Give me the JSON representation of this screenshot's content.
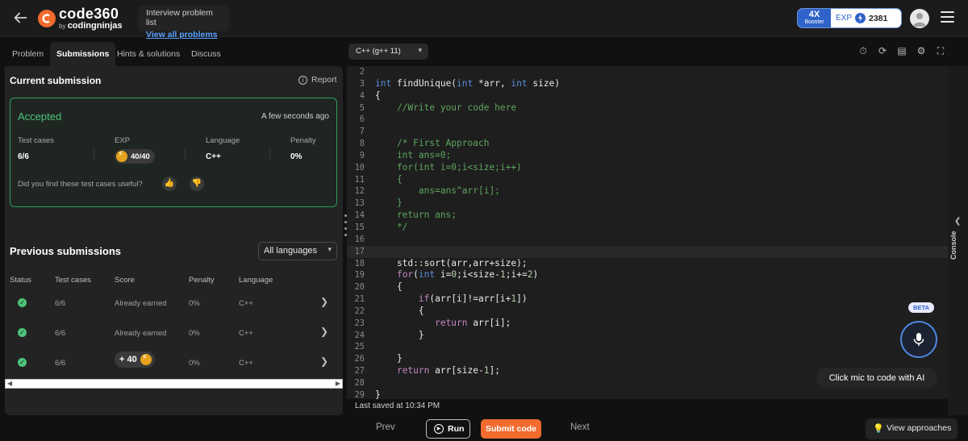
{
  "header": {
    "logo_main": "code360",
    "logo_by": "by",
    "logo_sub": "codingninjas",
    "list_title": "Interview problem list",
    "list_link": "View all problems",
    "booster_multiplier": "4X",
    "booster_label": "Booster",
    "exp_label": "EXP",
    "exp_value": "2381",
    "accent_color": "#f26b2e",
    "link_color": "#5aa2ff"
  },
  "left_tabs": [
    "Problem",
    "Submissions",
    "Hints & solutions",
    "Discuss"
  ],
  "current": {
    "title": "Current submission",
    "report": "Report",
    "status": "Accepted",
    "time": "A few seconds ago",
    "stats": [
      {
        "label": "Test cases",
        "value": "6/6"
      },
      {
        "label": "EXP",
        "value": "40/40"
      },
      {
        "label": "Language",
        "value": "C++"
      },
      {
        "label": "Penalty",
        "value": "0%"
      }
    ],
    "useful_question": "Did you find these test cases useful?"
  },
  "previous": {
    "title": "Previous submissions",
    "language_filter": "All languages",
    "headers": [
      "Status",
      "Test cases",
      "Score",
      "Penalty",
      "Language"
    ],
    "rows": [
      {
        "tests": "6/6",
        "score": "Already earned",
        "penalty": "0%",
        "language": "C++"
      },
      {
        "tests": "6/6",
        "score": "Already earned",
        "penalty": "0%",
        "language": "C++"
      },
      {
        "tests": "6/6",
        "score": "+ 40",
        "penalty": "0%",
        "language": "C++"
      }
    ]
  },
  "editor": {
    "language": "C++ (g++ 11)",
    "last_saved": "Last saved at 10:34 PM",
    "console_label": "Console",
    "beta": "BETA",
    "mic_tip": "Click mic to code with AI",
    "lines": [
      {
        "n": "2",
        "t": ""
      },
      {
        "n": "3",
        "t": "int findUnique(int *arr, int size)"
      },
      {
        "n": "4",
        "t": "{"
      },
      {
        "n": "5",
        "t": "    //Write your code here"
      },
      {
        "n": "6",
        "t": ""
      },
      {
        "n": "7",
        "t": ""
      },
      {
        "n": "8",
        "t": "    /* First Approach"
      },
      {
        "n": "9",
        "t": "    int ans=0;"
      },
      {
        "n": "10",
        "t": "    for(int i=0;i<size;i++)"
      },
      {
        "n": "11",
        "t": "    {"
      },
      {
        "n": "12",
        "t": "        ans=ans^arr[i];"
      },
      {
        "n": "13",
        "t": "    }"
      },
      {
        "n": "14",
        "t": "    return ans;"
      },
      {
        "n": "15",
        "t": "    */"
      },
      {
        "n": "16",
        "t": ""
      },
      {
        "n": "17",
        "t": ""
      },
      {
        "n": "18",
        "t": "    std::sort(arr,arr+size);"
      },
      {
        "n": "19",
        "t": "    for(int i=0;i<size-1;i+=2)"
      },
      {
        "n": "20",
        "t": "    {"
      },
      {
        "n": "21",
        "t": "        if(arr[i]!=arr[i+1])"
      },
      {
        "n": "22",
        "t": "        {"
      },
      {
        "n": "23",
        "t": "           return arr[i];"
      },
      {
        "n": "24",
        "t": "        }"
      },
      {
        "n": "25",
        "t": ""
      },
      {
        "n": "26",
        "t": "    }"
      },
      {
        "n": "27",
        "t": "    return arr[size-1];"
      },
      {
        "n": "28",
        "t": ""
      },
      {
        "n": "29",
        "t": "}"
      }
    ]
  },
  "bottom": {
    "prev": "Prev",
    "run": "Run",
    "submit": "Submit code",
    "next": "Next",
    "approaches": "View approaches"
  }
}
